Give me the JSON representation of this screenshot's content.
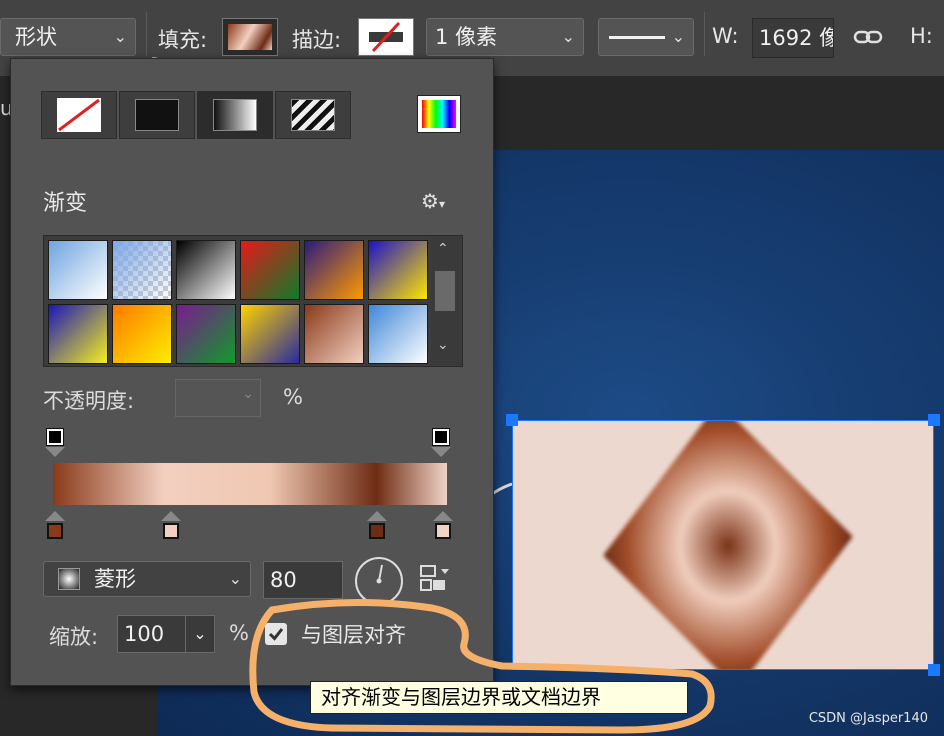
{
  "toolbar": {
    "mode_label": "形状",
    "fill_label": "填充:",
    "stroke_label": "描边:",
    "stroke_width": "1 像素",
    "w_label": "W:",
    "w_value": "1692 像",
    "h_label": "H:"
  },
  "panel": {
    "section_title": "渐变",
    "opacity_label": "不透明度:",
    "opacity_value": "",
    "opacity_unit": "%",
    "gradient_type": "菱形",
    "angle_value": "80",
    "scale_label": "缩放:",
    "scale_value": "100",
    "scale_unit": "%",
    "align_label": "与图层对齐",
    "align_checked": true
  },
  "tooltip": "对齐渐变与图层边界或文档边界",
  "watermark": "CSDN @Jasper140",
  "gradient_stops": {
    "opacity_stops": [
      "#000000",
      "#000000"
    ],
    "color_stops": [
      "#8a3a1a",
      "#f2cfc0",
      "#6e2c14",
      "#efd3c7"
    ]
  },
  "swatches": [
    [
      "#6fa4e0",
      "#ffffff"
    ],
    [
      "#7fa8e6",
      "transparent"
    ],
    [
      "#000000",
      "#ffffff"
    ],
    [
      "#e41a1a",
      "#0e7a2a"
    ],
    [
      "#2b1c7e",
      "#ff9a00"
    ],
    [
      "#1d11c8",
      "#ffe600"
    ],
    [
      "#1a18b8",
      "#f6ee20"
    ],
    [
      "#ff7a00",
      "#ffee00"
    ],
    [
      "#7a1a8e",
      "#119a2a"
    ],
    [
      "#ffd200",
      "#2a2a9e"
    ],
    [
      "#8a3a1a",
      "#f2cfc0"
    ],
    [
      "#3f87d8",
      "#ffffff"
    ]
  ],
  "accent": "#1c78ff"
}
